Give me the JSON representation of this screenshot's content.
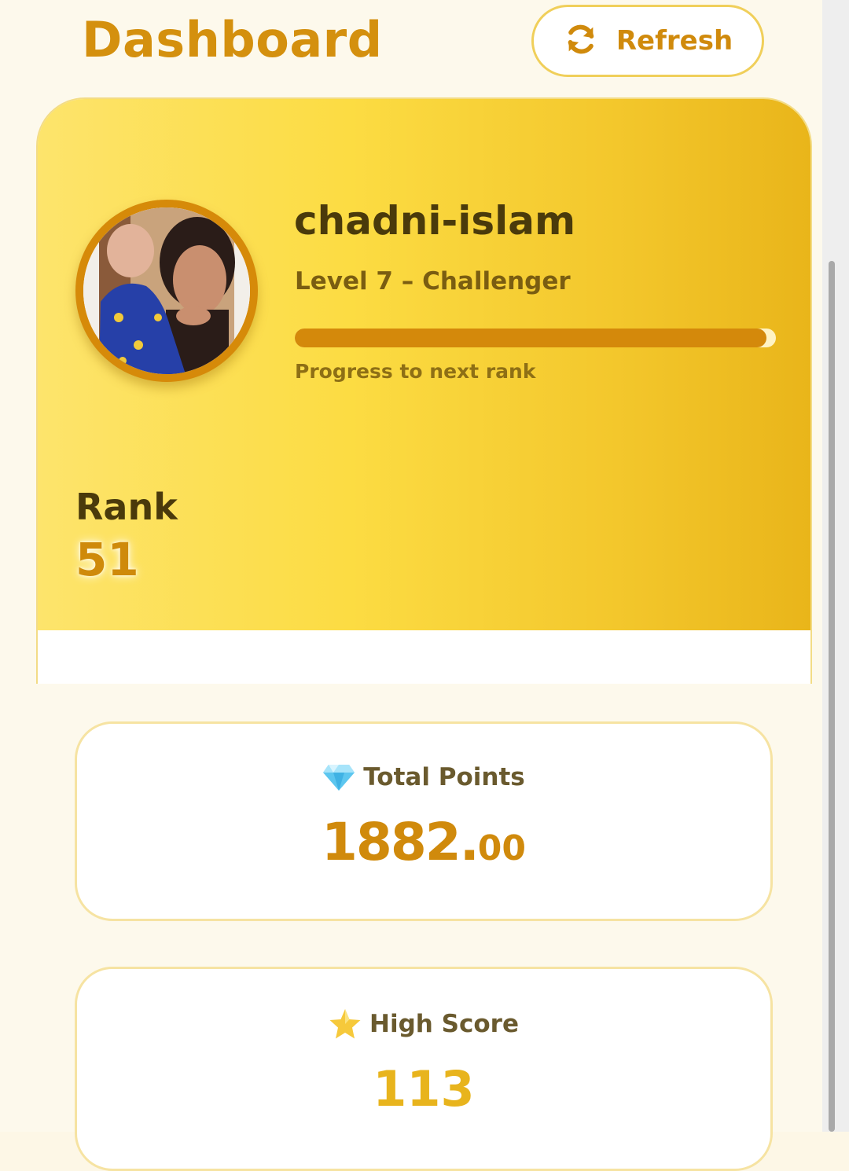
{
  "header": {
    "title": "Dashboard",
    "refresh_label": "Refresh",
    "refresh_icon": "refresh-icon"
  },
  "profile": {
    "username": "chadni-islam",
    "level_text": "Level 7 – Challenger",
    "progress_fraction": 0.98,
    "progress_caption": "Progress to next rank",
    "rank_label": "Rank",
    "rank_value": "51"
  },
  "stats": {
    "total_points": {
      "icon": "gem-icon",
      "label": "Total Points",
      "value_int": "1882.",
      "value_dec": "00"
    },
    "high_score": {
      "icon": "star-icon",
      "label": "High Score",
      "value": "113"
    }
  },
  "colors": {
    "accent": "#d4900e",
    "card_gradient_start": "#fde46c",
    "card_gradient_end": "#e9b51a",
    "dark_text": "#4a3a0b"
  }
}
